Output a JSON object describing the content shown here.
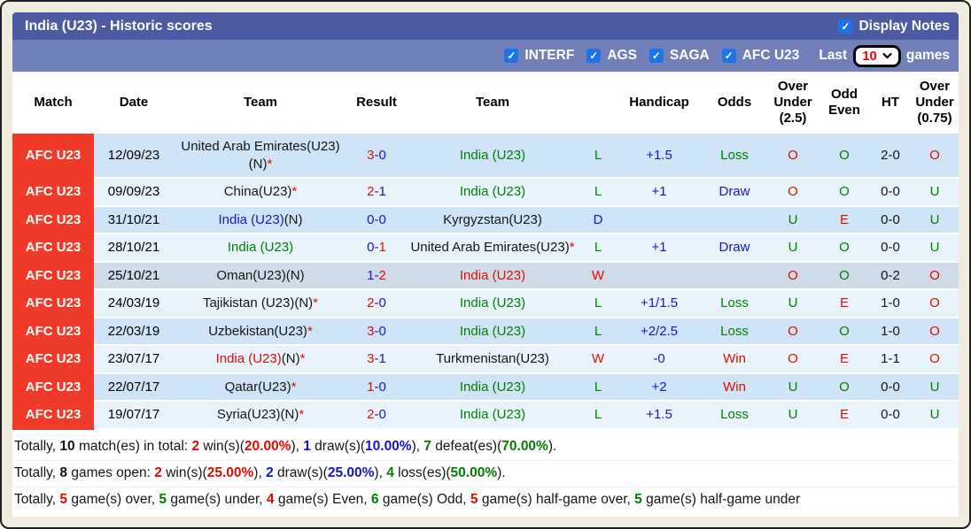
{
  "colors": {
    "black": "#151515",
    "red": "#e00c00",
    "green": "#008000",
    "blue": "#1515cc",
    "badge_red": "#f13b2a",
    "title_bar_bg": "#4d5ba5",
    "filter_bar_bg": "#7280b9",
    "checkbox_blue": "#1b74e8",
    "row_blue": "#cfe4f6",
    "row_light": "#e9f3fc",
    "row_gray": "#cedcea"
  },
  "icons": {
    "check": "✓"
  },
  "title_bar": {
    "title": "India (U23) - Historic scores",
    "display_notes_label": "Display Notes"
  },
  "filter_bar": {
    "checkboxes": [
      "INTERF",
      "AGS",
      "SAGA",
      "AFC U23"
    ],
    "last_label": "Last",
    "last_value": "10",
    "games_label": "games"
  },
  "table": {
    "headers": [
      "Match",
      "Date",
      "Team",
      "Result",
      "Team",
      "",
      "Handicap",
      "Odds",
      "Over Under (2.5)",
      "Odd Even",
      "HT",
      "Over Under (0.75)"
    ],
    "rows": [
      {
        "match": "AFC U23",
        "date": "12/09/23",
        "shade": "blue",
        "team1": [
          {
            "t": "United Arab Emirates(U23)(N)",
            "c": "black"
          },
          {
            "t": "*",
            "c": "red"
          }
        ],
        "result": {
          "h": "3",
          "a": "0",
          "hc": "red",
          "ac": "blue"
        },
        "team2": [
          {
            "t": "India (U23)",
            "c": "green"
          }
        ],
        "wdl": {
          "t": "L",
          "c": "green"
        },
        "handicap": {
          "t": "+1.5",
          "c": "blue"
        },
        "odds": {
          "t": "Loss",
          "c": "green"
        },
        "ou25": {
          "t": "O",
          "c": "red"
        },
        "oddeven": {
          "t": "O",
          "c": "green"
        },
        "ht": {
          "t": "2-0",
          "c": "black"
        },
        "ou075": {
          "t": "O",
          "c": "red"
        }
      },
      {
        "match": "AFC U23",
        "date": "09/09/23",
        "shade": "light",
        "team1": [
          {
            "t": "China(U23)",
            "c": "black"
          },
          {
            "t": "*",
            "c": "red"
          }
        ],
        "result": {
          "h": "2",
          "a": "1",
          "hc": "red",
          "ac": "blue"
        },
        "team2": [
          {
            "t": "India (U23)",
            "c": "green"
          }
        ],
        "wdl": {
          "t": "L",
          "c": "green"
        },
        "handicap": {
          "t": "+1",
          "c": "blue"
        },
        "odds": {
          "t": "Draw",
          "c": "blue"
        },
        "ou25": {
          "t": "O",
          "c": "red"
        },
        "oddeven": {
          "t": "O",
          "c": "green"
        },
        "ht": {
          "t": "0-0",
          "c": "black"
        },
        "ou075": {
          "t": "U",
          "c": "green"
        }
      },
      {
        "match": "AFC U23",
        "date": "31/10/21",
        "shade": "blue",
        "team1": [
          {
            "t": "India (U23)",
            "c": "blue"
          },
          {
            "t": "(N)",
            "c": "black"
          }
        ],
        "result": {
          "h": "0",
          "a": "0",
          "hc": "blue",
          "ac": "blue"
        },
        "team2": [
          {
            "t": "Kyrgyzstan(U23)",
            "c": "black"
          }
        ],
        "wdl": {
          "t": "D",
          "c": "blue"
        },
        "handicap": {
          "t": "",
          "c": "blue"
        },
        "odds": {
          "t": "",
          "c": "black"
        },
        "ou25": {
          "t": "U",
          "c": "green"
        },
        "oddeven": {
          "t": "E",
          "c": "red"
        },
        "ht": {
          "t": "0-0",
          "c": "black"
        },
        "ou075": {
          "t": "U",
          "c": "green"
        }
      },
      {
        "match": "AFC U23",
        "date": "28/10/21",
        "shade": "light",
        "team1": [
          {
            "t": "India (U23)",
            "c": "green"
          }
        ],
        "result": {
          "h": "0",
          "a": "1",
          "hc": "blue",
          "ac": "red"
        },
        "team2": [
          {
            "t": "United Arab Emirates(U23)",
            "c": "black"
          },
          {
            "t": "*",
            "c": "red"
          }
        ],
        "wdl": {
          "t": "L",
          "c": "green"
        },
        "handicap": {
          "t": "+1",
          "c": "blue"
        },
        "odds": {
          "t": "Draw",
          "c": "blue"
        },
        "ou25": {
          "t": "U",
          "c": "green"
        },
        "oddeven": {
          "t": "O",
          "c": "green"
        },
        "ht": {
          "t": "0-0",
          "c": "black"
        },
        "ou075": {
          "t": "U",
          "c": "green"
        }
      },
      {
        "match": "AFC U23",
        "date": "25/10/21",
        "shade": "gray",
        "team1": [
          {
            "t": "Oman(U23)(N)",
            "c": "black"
          }
        ],
        "result": {
          "h": "1",
          "a": "2",
          "hc": "blue",
          "ac": "red"
        },
        "team2": [
          {
            "t": "India (U23)",
            "c": "red"
          }
        ],
        "wdl": {
          "t": "W",
          "c": "red"
        },
        "handicap": {
          "t": "",
          "c": "blue"
        },
        "odds": {
          "t": "",
          "c": "black"
        },
        "ou25": {
          "t": "O",
          "c": "red"
        },
        "oddeven": {
          "t": "O",
          "c": "green"
        },
        "ht": {
          "t": "0-2",
          "c": "black"
        },
        "ou075": {
          "t": "O",
          "c": "red"
        }
      },
      {
        "match": "AFC U23",
        "date": "24/03/19",
        "shade": "light",
        "team1": [
          {
            "t": "Tajikistan (U23)(N)",
            "c": "black"
          },
          {
            "t": "*",
            "c": "red"
          }
        ],
        "result": {
          "h": "2",
          "a": "0",
          "hc": "red",
          "ac": "blue"
        },
        "team2": [
          {
            "t": "India (U23)",
            "c": "green"
          }
        ],
        "wdl": {
          "t": "L",
          "c": "green"
        },
        "handicap": {
          "t": "+1/1.5",
          "c": "blue"
        },
        "odds": {
          "t": "Loss",
          "c": "green"
        },
        "ou25": {
          "t": "U",
          "c": "green"
        },
        "oddeven": {
          "t": "E",
          "c": "red"
        },
        "ht": {
          "t": "1-0",
          "c": "black"
        },
        "ou075": {
          "t": "O",
          "c": "red"
        }
      },
      {
        "match": "AFC U23",
        "date": "22/03/19",
        "shade": "blue",
        "team1": [
          {
            "t": "Uzbekistan(U23)",
            "c": "black"
          },
          {
            "t": "*",
            "c": "red"
          }
        ],
        "result": {
          "h": "3",
          "a": "0",
          "hc": "red",
          "ac": "blue"
        },
        "team2": [
          {
            "t": "India (U23)",
            "c": "green"
          }
        ],
        "wdl": {
          "t": "L",
          "c": "green"
        },
        "handicap": {
          "t": "+2/2.5",
          "c": "blue"
        },
        "odds": {
          "t": "Loss",
          "c": "green"
        },
        "ou25": {
          "t": "O",
          "c": "red"
        },
        "oddeven": {
          "t": "O",
          "c": "green"
        },
        "ht": {
          "t": "1-0",
          "c": "black"
        },
        "ou075": {
          "t": "O",
          "c": "red"
        }
      },
      {
        "match": "AFC U23",
        "date": "23/07/17",
        "shade": "light",
        "team1": [
          {
            "t": "India (U23)",
            "c": "red"
          },
          {
            "t": "(N)",
            "c": "black"
          },
          {
            "t": "*",
            "c": "red"
          }
        ],
        "result": {
          "h": "3",
          "a": "1",
          "hc": "red",
          "ac": "blue"
        },
        "team2": [
          {
            "t": "Turkmenistan(U23)",
            "c": "black"
          }
        ],
        "wdl": {
          "t": "W",
          "c": "red"
        },
        "handicap": {
          "t": "-0",
          "c": "blue"
        },
        "odds": {
          "t": "Win",
          "c": "red"
        },
        "ou25": {
          "t": "O",
          "c": "red"
        },
        "oddeven": {
          "t": "E",
          "c": "red"
        },
        "ht": {
          "t": "1-1",
          "c": "black"
        },
        "ou075": {
          "t": "O",
          "c": "red"
        }
      },
      {
        "match": "AFC U23",
        "date": "22/07/17",
        "shade": "blue",
        "team1": [
          {
            "t": "Qatar(U23)",
            "c": "black"
          },
          {
            "t": "*",
            "c": "red"
          }
        ],
        "result": {
          "h": "1",
          "a": "0",
          "hc": "red",
          "ac": "blue"
        },
        "team2": [
          {
            "t": "India (U23)",
            "c": "green"
          }
        ],
        "wdl": {
          "t": "L",
          "c": "green"
        },
        "handicap": {
          "t": "+2",
          "c": "blue"
        },
        "odds": {
          "t": "Win",
          "c": "red"
        },
        "ou25": {
          "t": "U",
          "c": "green"
        },
        "oddeven": {
          "t": "O",
          "c": "green"
        },
        "ht": {
          "t": "0-0",
          "c": "black"
        },
        "ou075": {
          "t": "U",
          "c": "green"
        }
      },
      {
        "match": "AFC U23",
        "date": "19/07/17",
        "shade": "light",
        "team1": [
          {
            "t": "Syria(U23)(N)",
            "c": "black"
          },
          {
            "t": "*",
            "c": "red"
          }
        ],
        "result": {
          "h": "2",
          "a": "0",
          "hc": "red",
          "ac": "blue"
        },
        "team2": [
          {
            "t": "India (U23)",
            "c": "green"
          }
        ],
        "wdl": {
          "t": "L",
          "c": "green"
        },
        "handicap": {
          "t": "+1.5",
          "c": "blue"
        },
        "odds": {
          "t": "Loss",
          "c": "green"
        },
        "ou25": {
          "t": "U",
          "c": "green"
        },
        "oddeven": {
          "t": "E",
          "c": "red"
        },
        "ht": {
          "t": "0-0",
          "c": "black"
        },
        "ou075": {
          "t": "U",
          "c": "green"
        }
      }
    ]
  },
  "summary": [
    [
      {
        "t": "Totally, "
      },
      {
        "t": "10",
        "b": 1
      },
      {
        "t": " match(es) in total: "
      },
      {
        "t": "2",
        "c": "red",
        "b": 1
      },
      {
        "t": " win(s)("
      },
      {
        "t": "20.00%",
        "c": "red",
        "b": 1
      },
      {
        "t": "), "
      },
      {
        "t": "1",
        "c": "blue",
        "b": 1
      },
      {
        "t": " draw(s)("
      },
      {
        "t": "10.00%",
        "c": "blue",
        "b": 1
      },
      {
        "t": "), "
      },
      {
        "t": "7",
        "c": "green",
        "b": 1
      },
      {
        "t": " defeat(es)("
      },
      {
        "t": "70.00%",
        "c": "green",
        "b": 1
      },
      {
        "t": ")."
      }
    ],
    [
      {
        "t": "Totally, "
      },
      {
        "t": "8",
        "b": 1
      },
      {
        "t": " games open: "
      },
      {
        "t": "2",
        "c": "red",
        "b": 1
      },
      {
        "t": " win(s)("
      },
      {
        "t": "25.00%",
        "c": "red",
        "b": 1
      },
      {
        "t": "), "
      },
      {
        "t": "2",
        "c": "blue",
        "b": 1
      },
      {
        "t": " draw(s)("
      },
      {
        "t": "25.00%",
        "c": "blue",
        "b": 1
      },
      {
        "t": "), "
      },
      {
        "t": "4",
        "c": "green",
        "b": 1
      },
      {
        "t": " loss(es)("
      },
      {
        "t": "50.00%",
        "c": "green",
        "b": 1
      },
      {
        "t": ")."
      }
    ],
    [
      {
        "t": "Totally, "
      },
      {
        "t": "5",
        "c": "red",
        "b": 1
      },
      {
        "t": " game(s) over, "
      },
      {
        "t": "5",
        "c": "green",
        "b": 1
      },
      {
        "t": " game(s) under, "
      },
      {
        "t": "4",
        "c": "red",
        "b": 1
      },
      {
        "t": " game(s) Even, "
      },
      {
        "t": "6",
        "c": "green",
        "b": 1
      },
      {
        "t": " game(s) Odd, "
      },
      {
        "t": "5",
        "c": "red",
        "b": 1
      },
      {
        "t": " game(s) half-game over, "
      },
      {
        "t": "5",
        "c": "green",
        "b": 1
      },
      {
        "t": " game(s) half-game under"
      }
    ]
  ]
}
